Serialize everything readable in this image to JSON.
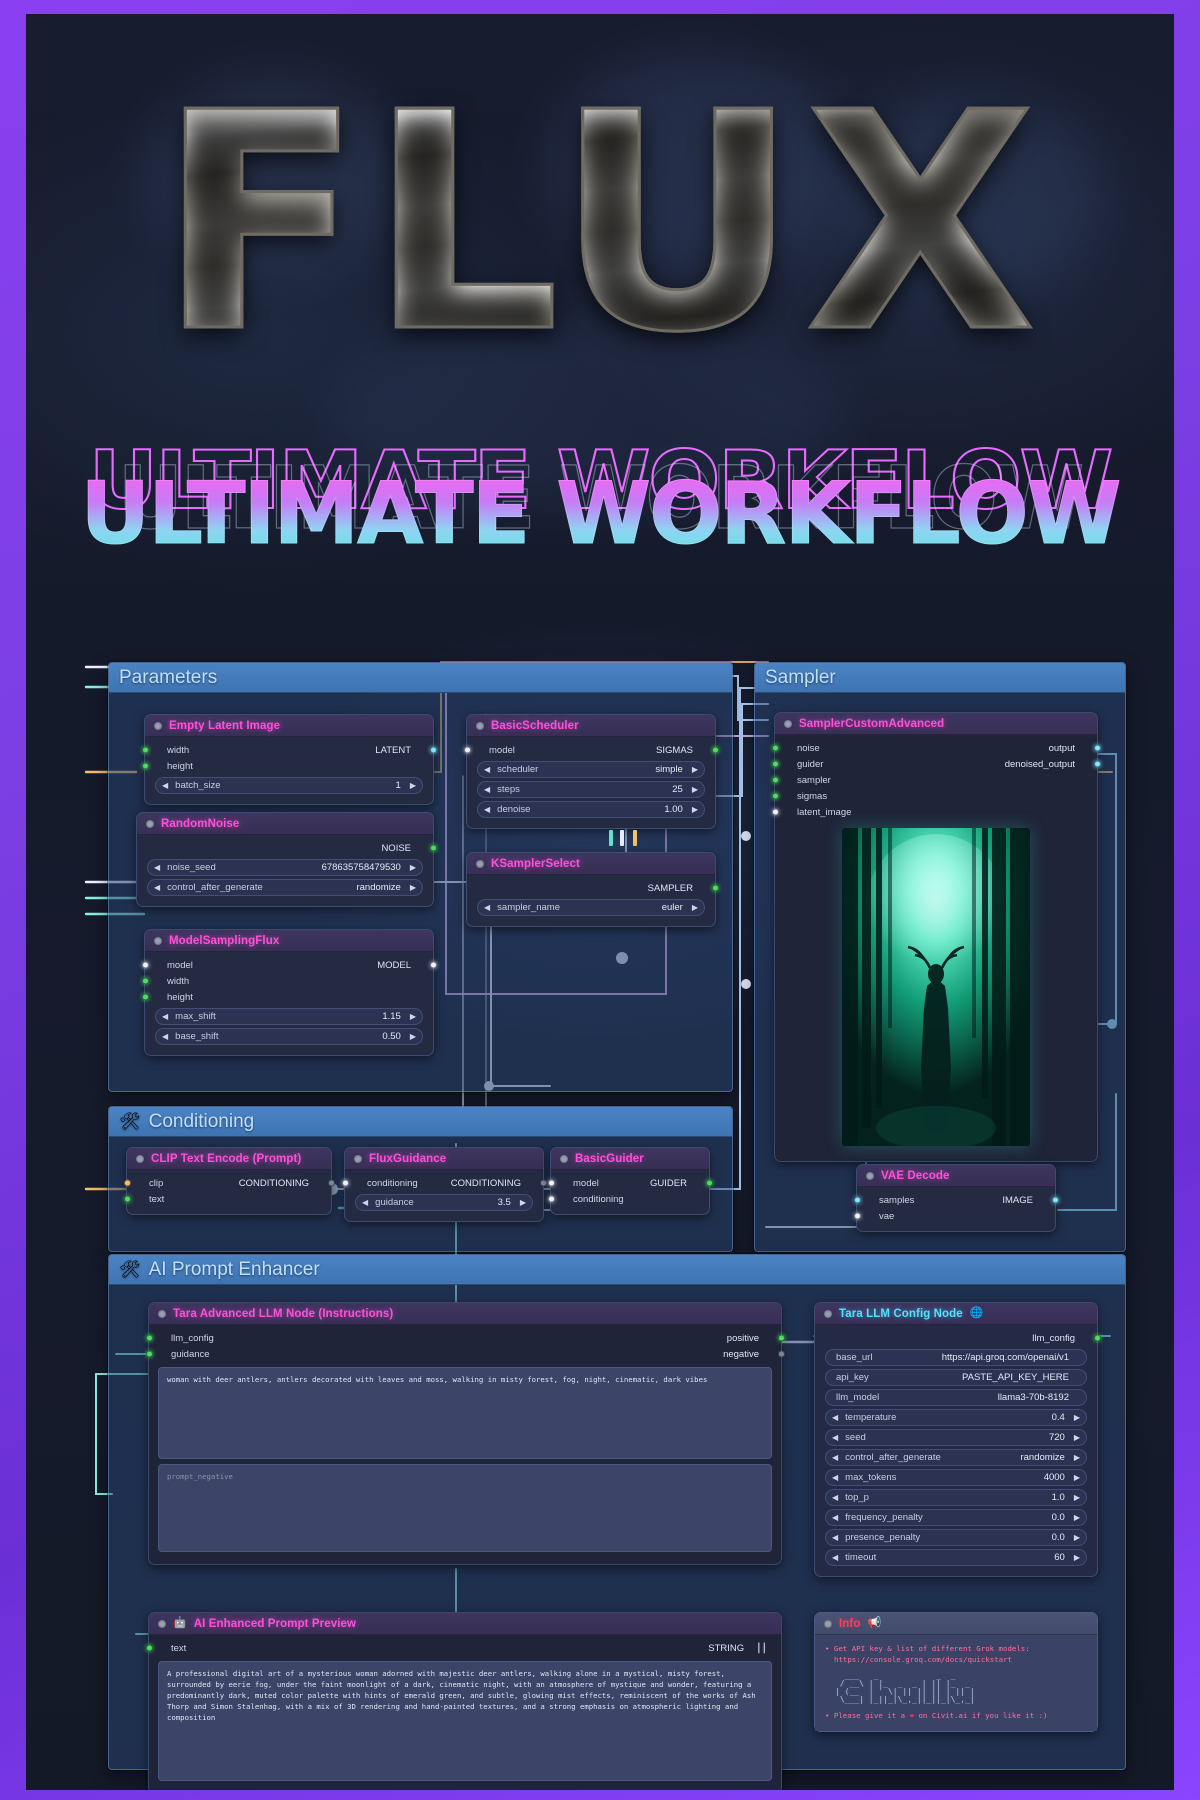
{
  "hero": {
    "title": "FLUX",
    "subtitle": "ULTIMATE WORKFLOW"
  },
  "groups": {
    "parameters": {
      "title": "Parameters",
      "icon": ""
    },
    "sampler": {
      "title": "Sampler",
      "icon": ""
    },
    "conditioning": {
      "title": "Conditioning",
      "icon": "tools-icon"
    },
    "enhancer": {
      "title": "AI Prompt Enhancer",
      "icon": "tools-icon"
    }
  },
  "nodes": {
    "empty_latent": {
      "title": "Empty Latent Image",
      "inputs": [
        {
          "name": "width",
          "color": "green"
        },
        {
          "name": "height",
          "color": "green"
        }
      ],
      "outputs": [
        {
          "name": "LATENT",
          "color": "cyan"
        }
      ],
      "widgets": [
        {
          "name": "batch_size",
          "value": "1"
        }
      ]
    },
    "random_noise": {
      "title": "RandomNoise",
      "inputs": [],
      "outputs": [
        {
          "name": "NOISE",
          "color": "green"
        }
      ],
      "widgets": [
        {
          "name": "noise_seed",
          "value": "678635758479530"
        },
        {
          "name": "control_after_generate",
          "value": "randomize"
        }
      ]
    },
    "model_sampling_flux": {
      "title": "ModelSamplingFlux",
      "inputs": [
        {
          "name": "model",
          "color": "white"
        },
        {
          "name": "width",
          "color": "green"
        },
        {
          "name": "height",
          "color": "green"
        }
      ],
      "outputs": [
        {
          "name": "MODEL",
          "color": "white"
        }
      ],
      "widgets": [
        {
          "name": "max_shift",
          "value": "1.15"
        },
        {
          "name": "base_shift",
          "value": "0.50"
        }
      ]
    },
    "basic_scheduler": {
      "title": "BasicScheduler",
      "inputs": [
        {
          "name": "model",
          "color": "white"
        }
      ],
      "outputs": [
        {
          "name": "SIGMAS",
          "color": "green"
        }
      ],
      "widgets": [
        {
          "name": "scheduler",
          "value": "simple"
        },
        {
          "name": "steps",
          "value": "25"
        },
        {
          "name": "denoise",
          "value": "1.00"
        }
      ]
    },
    "ksampler_select": {
      "title": "KSamplerSelect",
      "inputs": [],
      "outputs": [
        {
          "name": "SAMPLER",
          "color": "green"
        }
      ],
      "widgets": [
        {
          "name": "sampler_name",
          "value": "euler"
        }
      ]
    },
    "sampler_custom_advanced": {
      "title": "SamplerCustomAdvanced",
      "inputs": [
        {
          "name": "noise",
          "color": "green"
        },
        {
          "name": "guider",
          "color": "green"
        },
        {
          "name": "sampler",
          "color": "green"
        },
        {
          "name": "sigmas",
          "color": "green"
        },
        {
          "name": "latent_image",
          "color": "white"
        }
      ],
      "outputs": [
        {
          "name": "output",
          "color": "cyan"
        },
        {
          "name": "denoised_output",
          "color": "cyan"
        }
      ]
    },
    "vae_decode": {
      "title": "VAE Decode",
      "inputs": [
        {
          "name": "samples",
          "color": "cyan"
        },
        {
          "name": "vae",
          "color": "white"
        }
      ],
      "outputs": [
        {
          "name": "IMAGE",
          "color": "cyan"
        }
      ]
    },
    "clip_text_encode": {
      "title": "CLIP Text Encode (Prompt)",
      "inputs": [
        {
          "name": "clip",
          "color": "orange"
        },
        {
          "name": "text",
          "color": "green"
        }
      ],
      "outputs": [
        {
          "name": "CONDITIONING",
          "color": "dim"
        }
      ]
    },
    "flux_guidance": {
      "title": "FluxGuidance",
      "inputs": [
        {
          "name": "conditioning",
          "color": "white"
        }
      ],
      "outputs": [
        {
          "name": "CONDITIONING",
          "color": "dim"
        }
      ],
      "widgets": [
        {
          "name": "guidance",
          "value": "3.5"
        }
      ]
    },
    "basic_guider": {
      "title": "BasicGuider",
      "inputs": [
        {
          "name": "model",
          "color": "white"
        },
        {
          "name": "conditioning",
          "color": "white"
        }
      ],
      "outputs": [
        {
          "name": "GUIDER",
          "color": "green"
        }
      ]
    },
    "tara_advanced_llm": {
      "title": "Tara Advanced LLM Node (Instructions)",
      "inputs": [
        {
          "name": "llm_config",
          "color": "green"
        },
        {
          "name": "guidance",
          "color": "green"
        }
      ],
      "outputs": [
        {
          "name": "positive",
          "color": "green"
        },
        {
          "name": "negative",
          "color": "dim"
        }
      ],
      "prompt_text": "woman with deer antlers, antlers decorated with leaves and moss, walking in misty forest, fog, night, cinematic, dark vibes",
      "negative_placeholder": "prompt_negative"
    },
    "tara_llm_config": {
      "title": "Tara LLM Config Node",
      "title_icon": "globe-icon",
      "outputs": [
        {
          "name": "llm_config",
          "color": "green"
        }
      ],
      "widgets": [
        {
          "name": "base_url",
          "value": "https://api.groq.com/openai/v1",
          "arrows": false
        },
        {
          "name": "api_key",
          "value": "PASTE_API_KEY_HERE",
          "arrows": false
        },
        {
          "name": "llm_model",
          "value": "llama3-70b-8192",
          "arrows": false
        },
        {
          "name": "temperature",
          "value": "0.4",
          "arrows": true
        },
        {
          "name": "seed",
          "value": "720",
          "arrows": true
        },
        {
          "name": "control_after_generate",
          "value": "randomize",
          "arrows": true
        },
        {
          "name": "max_tokens",
          "value": "4000",
          "arrows": true
        },
        {
          "name": "top_p",
          "value": "1.0",
          "arrows": true
        },
        {
          "name": "frequency_penalty",
          "value": "0.0",
          "arrows": true
        },
        {
          "name": "presence_penalty",
          "value": "0.0",
          "arrows": true
        },
        {
          "name": "timeout",
          "value": "60",
          "arrows": true
        }
      ]
    },
    "ai_preview": {
      "title": "AI Enhanced Prompt Preview",
      "title_icon": "robot-icon",
      "inputs": [
        {
          "name": "text",
          "color": "green"
        }
      ],
      "outputs": [
        {
          "name": "STRING",
          "color": "none"
        }
      ],
      "preview_text": "A professional digital art of a mysterious woman adorned with majestic deer antlers, walking alone in a mystical, misty forest, surrounded by eerie fog, under the faint moonlight of a dark, cinematic night, with an atmosphere of mystique and wonder, featuring a predominantly dark, muted color palette with hints of emerald green, and subtle, glowing mist effects, reminiscent of the works of Ash Thorp and Simon Stalenhag, with a mix of 3D rendering and hand-painted textures, and a strong emphasis on atmospheric lighting and composition"
    },
    "info": {
      "title": "Info",
      "title_icon": "megaphone-icon",
      "line1": "Get API key & list of different Grok models:",
      "line2": "https://console.groq.com/docs/quickstart",
      "ascii": "  ___   _            _  _     \n / __\\ | |_  _  _ | || |_  _ \n| (__  | ' \\| || || || | || |\n \\___| |_||_|\\_,_||_||_|\\_,_|",
      "ascii_label": "Cthulhu",
      "line3_pre": "Please give it a ",
      "line3_heart": "❤",
      "line3_post": " on Civit.ai if you like it :)"
    }
  },
  "colors": {
    "accent_pink": "#ff4fd8",
    "accent_cyan": "#4fe3ff",
    "group_header": "#4a83c4",
    "node_bg": "#232a42",
    "frame": "#7b3fe4"
  }
}
